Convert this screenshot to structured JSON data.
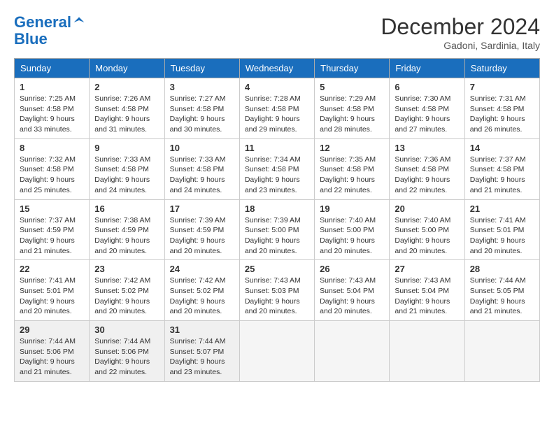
{
  "header": {
    "logo_line1": "General",
    "logo_line2": "Blue",
    "month": "December 2024",
    "location": "Gadoni, Sardinia, Italy"
  },
  "days_of_week": [
    "Sunday",
    "Monday",
    "Tuesday",
    "Wednesday",
    "Thursday",
    "Friday",
    "Saturday"
  ],
  "weeks": [
    [
      {
        "day": "1",
        "sunrise": "7:25 AM",
        "sunset": "4:58 PM",
        "daylight": "9 hours and 33 minutes."
      },
      {
        "day": "2",
        "sunrise": "7:26 AM",
        "sunset": "4:58 PM",
        "daylight": "9 hours and 31 minutes."
      },
      {
        "day": "3",
        "sunrise": "7:27 AM",
        "sunset": "4:58 PM",
        "daylight": "9 hours and 30 minutes."
      },
      {
        "day": "4",
        "sunrise": "7:28 AM",
        "sunset": "4:58 PM",
        "daylight": "9 hours and 29 minutes."
      },
      {
        "day": "5",
        "sunrise": "7:29 AM",
        "sunset": "4:58 PM",
        "daylight": "9 hours and 28 minutes."
      },
      {
        "day": "6",
        "sunrise": "7:30 AM",
        "sunset": "4:58 PM",
        "daylight": "9 hours and 27 minutes."
      },
      {
        "day": "7",
        "sunrise": "7:31 AM",
        "sunset": "4:58 PM",
        "daylight": "9 hours and 26 minutes."
      }
    ],
    [
      {
        "day": "8",
        "sunrise": "7:32 AM",
        "sunset": "4:58 PM",
        "daylight": "9 hours and 25 minutes."
      },
      {
        "day": "9",
        "sunrise": "7:33 AM",
        "sunset": "4:58 PM",
        "daylight": "9 hours and 24 minutes."
      },
      {
        "day": "10",
        "sunrise": "7:33 AM",
        "sunset": "4:58 PM",
        "daylight": "9 hours and 24 minutes."
      },
      {
        "day": "11",
        "sunrise": "7:34 AM",
        "sunset": "4:58 PM",
        "daylight": "9 hours and 23 minutes."
      },
      {
        "day": "12",
        "sunrise": "7:35 AM",
        "sunset": "4:58 PM",
        "daylight": "9 hours and 22 minutes."
      },
      {
        "day": "13",
        "sunrise": "7:36 AM",
        "sunset": "4:58 PM",
        "daylight": "9 hours and 22 minutes."
      },
      {
        "day": "14",
        "sunrise": "7:37 AM",
        "sunset": "4:58 PM",
        "daylight": "9 hours and 21 minutes."
      }
    ],
    [
      {
        "day": "15",
        "sunrise": "7:37 AM",
        "sunset": "4:59 PM",
        "daylight": "9 hours and 21 minutes."
      },
      {
        "day": "16",
        "sunrise": "7:38 AM",
        "sunset": "4:59 PM",
        "daylight": "9 hours and 20 minutes."
      },
      {
        "day": "17",
        "sunrise": "7:39 AM",
        "sunset": "4:59 PM",
        "daylight": "9 hours and 20 minutes."
      },
      {
        "day": "18",
        "sunrise": "7:39 AM",
        "sunset": "5:00 PM",
        "daylight": "9 hours and 20 minutes."
      },
      {
        "day": "19",
        "sunrise": "7:40 AM",
        "sunset": "5:00 PM",
        "daylight": "9 hours and 20 minutes."
      },
      {
        "day": "20",
        "sunrise": "7:40 AM",
        "sunset": "5:00 PM",
        "daylight": "9 hours and 20 minutes."
      },
      {
        "day": "21",
        "sunrise": "7:41 AM",
        "sunset": "5:01 PM",
        "daylight": "9 hours and 20 minutes."
      }
    ],
    [
      {
        "day": "22",
        "sunrise": "7:41 AM",
        "sunset": "5:01 PM",
        "daylight": "9 hours and 20 minutes."
      },
      {
        "day": "23",
        "sunrise": "7:42 AM",
        "sunset": "5:02 PM",
        "daylight": "9 hours and 20 minutes."
      },
      {
        "day": "24",
        "sunrise": "7:42 AM",
        "sunset": "5:02 PM",
        "daylight": "9 hours and 20 minutes."
      },
      {
        "day": "25",
        "sunrise": "7:43 AM",
        "sunset": "5:03 PM",
        "daylight": "9 hours and 20 minutes."
      },
      {
        "day": "26",
        "sunrise": "7:43 AM",
        "sunset": "5:04 PM",
        "daylight": "9 hours and 20 minutes."
      },
      {
        "day": "27",
        "sunrise": "7:43 AM",
        "sunset": "5:04 PM",
        "daylight": "9 hours and 21 minutes."
      },
      {
        "day": "28",
        "sunrise": "7:44 AM",
        "sunset": "5:05 PM",
        "daylight": "9 hours and 21 minutes."
      }
    ],
    [
      {
        "day": "29",
        "sunrise": "7:44 AM",
        "sunset": "5:06 PM",
        "daylight": "9 hours and 21 minutes."
      },
      {
        "day": "30",
        "sunrise": "7:44 AM",
        "sunset": "5:06 PM",
        "daylight": "9 hours and 22 minutes."
      },
      {
        "day": "31",
        "sunrise": "7:44 AM",
        "sunset": "5:07 PM",
        "daylight": "9 hours and 23 minutes."
      },
      null,
      null,
      null,
      null
    ]
  ]
}
